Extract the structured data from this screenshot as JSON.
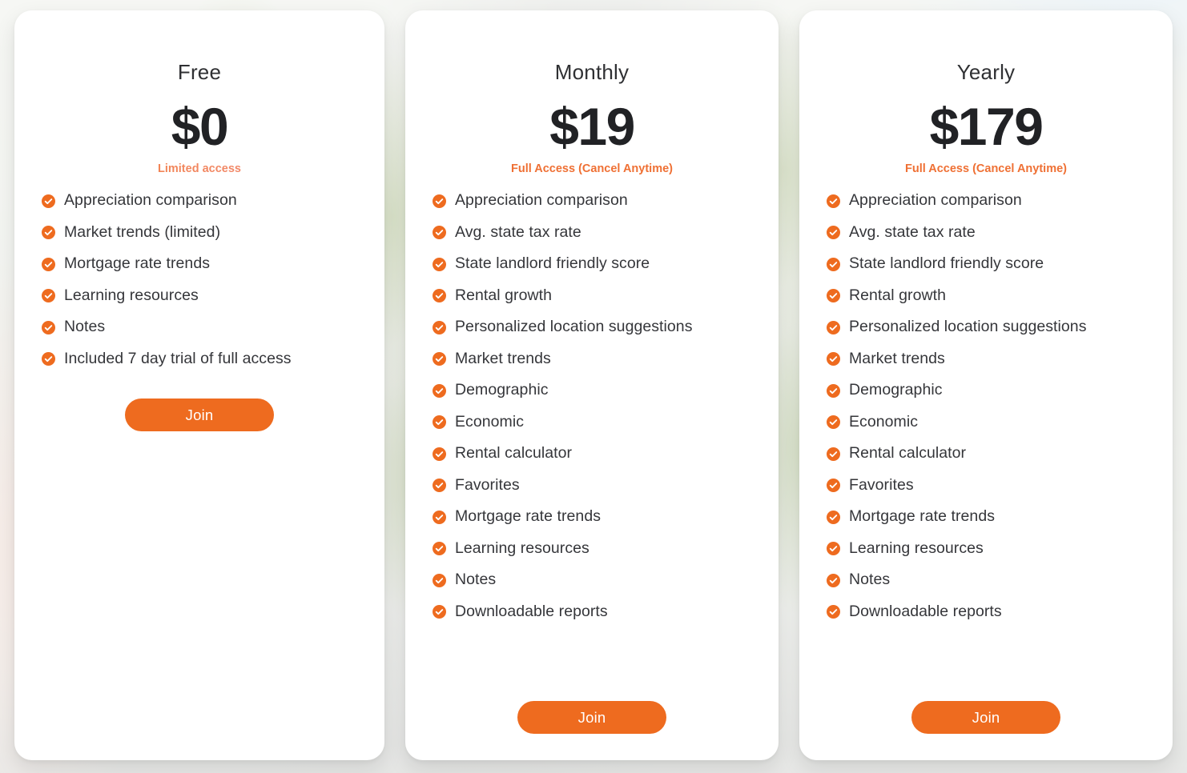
{
  "theme": {
    "accent": "#ee6b1f",
    "accent_text": "#ef7034",
    "card_background": "#ffffff",
    "text_primary": "#35363a",
    "price_color": "#212225"
  },
  "plans": [
    {
      "id": "free",
      "name": "Free",
      "price": "$0",
      "subtitle": "Limited access",
      "subtitle_style": "gradient",
      "features": [
        "Appreciation comparison",
        "Market trends (limited)",
        "Mortgage rate trends",
        "Learning resources",
        "Notes",
        "Included 7 day trial of full access"
      ],
      "cta_label": "Join",
      "cta_position": "after-list"
    },
    {
      "id": "monthly",
      "name": "Monthly",
      "price": "$19",
      "subtitle": "Full Access (Cancel Anytime)",
      "subtitle_style": "solid",
      "features": [
        "Appreciation comparison",
        "Avg. state tax rate",
        "State landlord friendly score",
        "Rental growth",
        "Personalized location suggestions",
        "Market trends",
        "Demographic",
        "Economic",
        "Rental calculator",
        "Favorites",
        "Mortgage rate trends",
        "Learning resources",
        "Notes",
        "Downloadable reports"
      ],
      "cta_label": "Join",
      "cta_position": "pinned"
    },
    {
      "id": "yearly",
      "name": "Yearly",
      "price": "$179",
      "subtitle": "Full Access (Cancel Anytime)",
      "subtitle_style": "solid",
      "features": [
        "Appreciation comparison",
        "Avg. state tax rate",
        "State landlord friendly score",
        "Rental growth",
        "Personalized location suggestions",
        "Market trends",
        "Demographic",
        "Economic",
        "Rental calculator",
        "Favorites",
        "Mortgage rate trends",
        "Learning resources",
        "Notes",
        "Downloadable reports"
      ],
      "cta_label": "Join",
      "cta_position": "pinned"
    }
  ],
  "icons": {
    "feature_bullet": "check-circle-icon"
  }
}
